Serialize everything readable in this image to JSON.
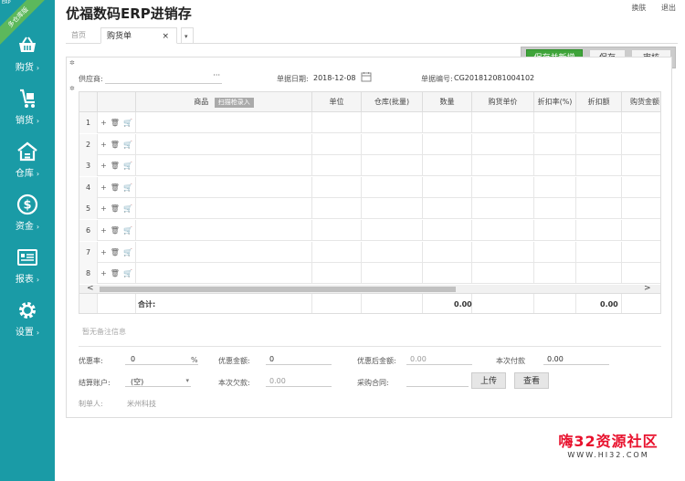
{
  "sidebar": {
    "badge": "多仓库版",
    "badge_small": "ERP",
    "items": [
      {
        "label": "购货",
        "icon": "basket-icon"
      },
      {
        "label": "销货",
        "icon": "cart-icon"
      },
      {
        "label": "仓库",
        "icon": "warehouse-icon"
      },
      {
        "label": "资金",
        "icon": "dollar-icon"
      },
      {
        "label": "报表",
        "icon": "report-icon"
      },
      {
        "label": "设置",
        "icon": "gear-icon"
      }
    ],
    "chevron": "›"
  },
  "header": {
    "title": "优福数码ERP进销存",
    "switch_account": "换肤",
    "logout": "退出"
  },
  "tabs": {
    "home": "首页",
    "purchase": "购货单",
    "close": "×",
    "more": "▾"
  },
  "actions": {
    "save_new": "保存并新增",
    "save": "保存",
    "audit": "审核"
  },
  "form": {
    "supplier_label": "供应商:",
    "supplier_more": "···",
    "date_label": "单据日期:",
    "date_value": "2018-12-08",
    "doc_no_label": "单据编号:",
    "doc_no_value": "CG201812081004102"
  },
  "grid": {
    "columns": [
      "商品",
      "单位",
      "仓库(批量)",
      "数量",
      "购货单价",
      "折扣率(%)",
      "折扣额",
      "购货金额"
    ],
    "scan_button": "扫描枪录入",
    "row_numbers": [
      "1",
      "2",
      "3",
      "4",
      "5",
      "6",
      "7",
      "8"
    ],
    "row_actions": "+ 🗑 🛒",
    "total_label": "合计:",
    "total_qty": "0.00",
    "total_discount": "0.00",
    "scroll_left": "<",
    "scroll_right": ">"
  },
  "memo": "暂无备注信息",
  "summary": {
    "discount_rate_label": "优惠率:",
    "discount_rate_value": "0",
    "percent": "%",
    "discount_amount_label": "优惠金额:",
    "discount_amount_value": "0",
    "after_discount_label": "优惠后金额:",
    "after_discount_value": "0.00",
    "this_payment_label": "本次付款",
    "this_payment_value": "0.00",
    "account_label": "结算账户:",
    "account_value": "(空)",
    "account_caret": "▾",
    "this_debt_label": "本次欠款:",
    "this_debt_value": "0.00",
    "contract_label": "采购合同:",
    "upload": "上传",
    "view": "查看",
    "maker_label": "制单人:",
    "maker_value": "米州科技"
  },
  "watermark": {
    "main": "嗨32资源社区",
    "url": "WWW.HI32.COM"
  }
}
